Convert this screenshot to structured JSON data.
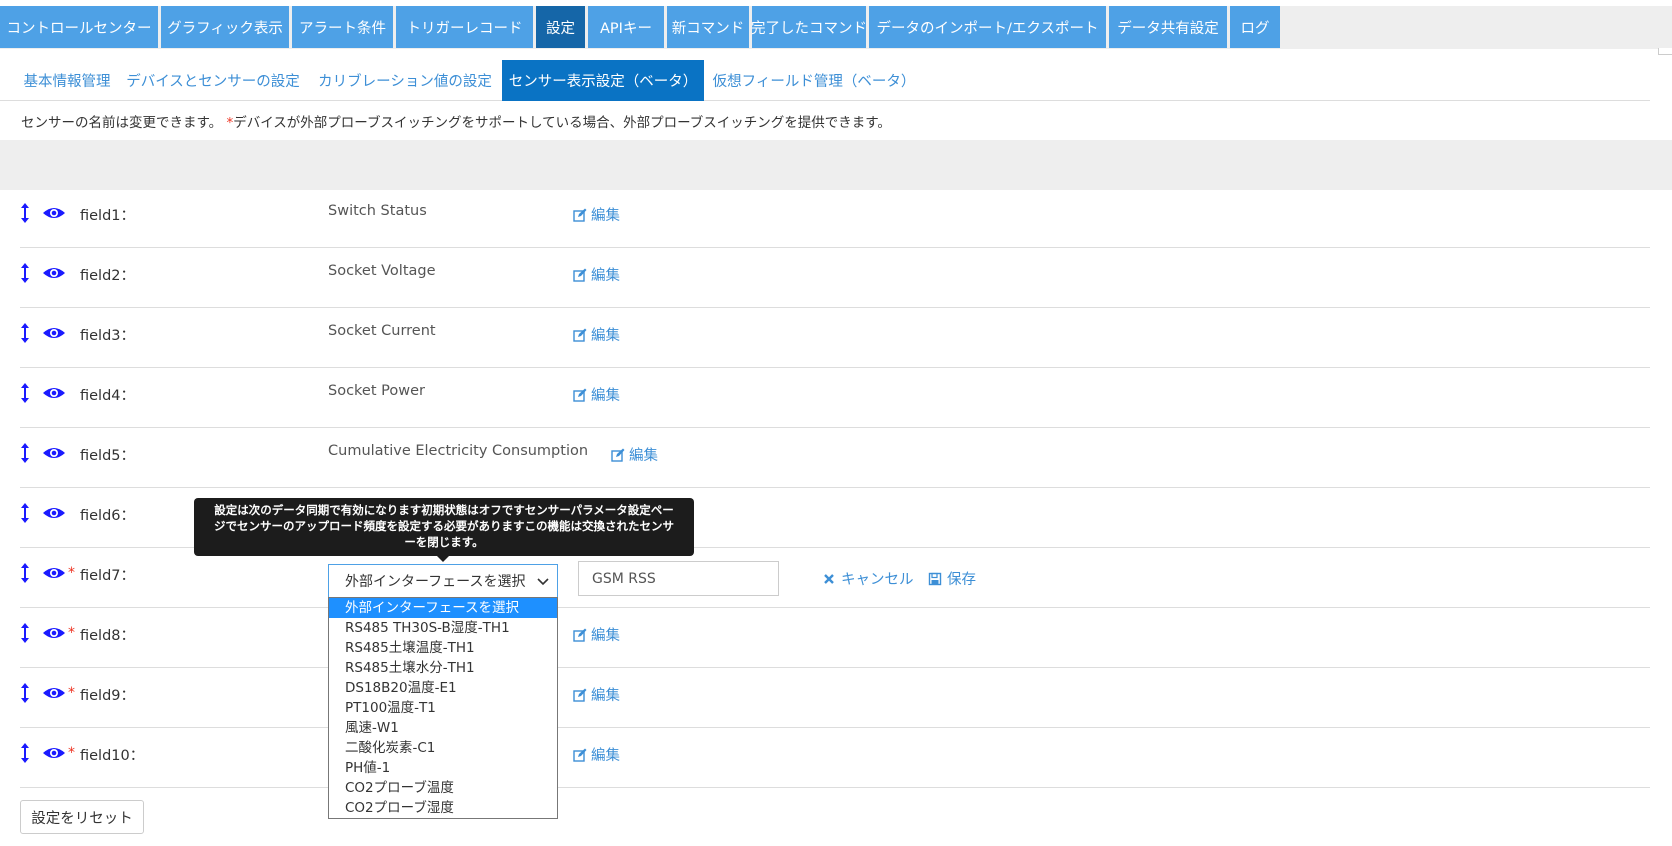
{
  "colors": {
    "tab_bg": "#4ea1e6",
    "tab_active": "#1566a8",
    "subtab_active": "#0a73c4",
    "link": "#3d8fd6",
    "icon": "#1a1aff",
    "required": "#e32222"
  },
  "top_tabs": [
    {
      "label": "コントロールセンター",
      "active": false
    },
    {
      "label": "グラフィック表示",
      "active": false
    },
    {
      "label": "アラート条件",
      "active": false
    },
    {
      "label": "トリガーレコード",
      "active": false
    },
    {
      "label": "設定",
      "active": true
    },
    {
      "label": "APIキー",
      "active": false
    },
    {
      "label": "新コマンド",
      "active": false
    },
    {
      "label": "完了したコマンド",
      "active": false
    },
    {
      "label": "データのインポート/エクスポート",
      "active": false
    },
    {
      "label": "データ共有設定",
      "active": false
    },
    {
      "label": "ログ",
      "active": false
    }
  ],
  "sub_tabs": [
    {
      "label": "基本情報管理",
      "active": false
    },
    {
      "label": "デバイスとセンサーの設定",
      "active": false
    },
    {
      "label": "カリブレーション値の設定",
      "active": false
    },
    {
      "label": "センサー表示設定（ベータ）",
      "active": true
    },
    {
      "label": "仮想フィールド管理（ベータ）",
      "active": false
    }
  ],
  "notice": {
    "text": "センサーの名前は変更できます。",
    "star": "*",
    "text2": "デバイスが外部プローブスイッチングをサポートしている場合、外部プローブスイッチングを提供できます。"
  },
  "fields": [
    {
      "name": "field1：",
      "value": "Switch Status",
      "required": false,
      "edit_label": "編集"
    },
    {
      "name": "field2：",
      "value": "Socket Voltage",
      "required": false,
      "edit_label": "編集"
    },
    {
      "name": "field3：",
      "value": "Socket Current",
      "required": false,
      "edit_label": "編集"
    },
    {
      "name": "field4：",
      "value": "Socket Power",
      "required": false,
      "edit_label": "編集"
    },
    {
      "name": "field5：",
      "value": "Cumulative Electricity Consumption",
      "required": false,
      "edit_label": "編集"
    },
    {
      "name": "field6：",
      "value": "",
      "required": false,
      "edit_label": ""
    },
    {
      "name": "field7：",
      "value": "",
      "required": true,
      "edit_label": ""
    },
    {
      "name": "field8：",
      "value": "",
      "required": true,
      "edit_label": "編集"
    },
    {
      "name": "field9：",
      "value": "",
      "required": true,
      "edit_label": "編集"
    },
    {
      "name": "field10：",
      "value": "",
      "required": true,
      "edit_label": "編集"
    }
  ],
  "editing": {
    "select_value": "外部インターフェースを選択",
    "input_value": "GSM RSS",
    "cancel_label": "キャンセル",
    "save_label": "保存"
  },
  "dropdown_options": [
    "外部インターフェースを選択",
    "RS485 TH30S-B湿度-TH1",
    "RS485土壌温度-TH1",
    "RS485土壌水分-TH1",
    "DS18B20温度-E1",
    "PT100温度-T1",
    "風速-W1",
    "二酸化炭素-C1",
    "PH値-1",
    "CO2プローブ温度",
    "CO2プローブ湿度"
  ],
  "tooltip": {
    "line1": "設定は次のデータ同期で有効になります初期状態はオフですセンサーパラメータ設定ペー",
    "line2": "ジでセンサーのアップロード頻度を設定する必要がありますこの機能は交換されたセンサ",
    "line3": "ーを閉じます。"
  },
  "reset_label": "設定をリセット"
}
